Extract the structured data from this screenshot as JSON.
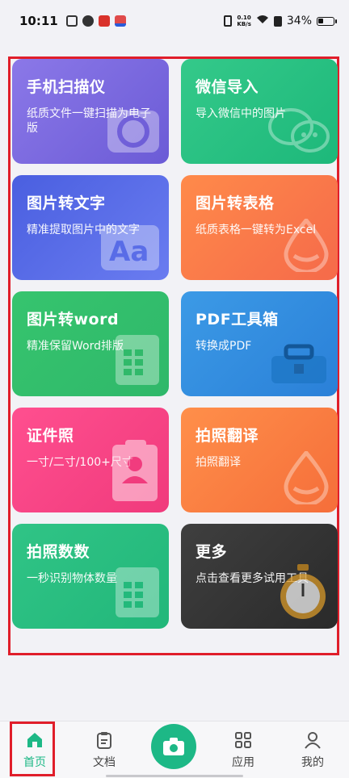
{
  "status_bar": {
    "time": "10:11",
    "netspeed_value": "0.10",
    "netspeed_unit": "KB/s",
    "battery": "34%"
  },
  "tools": [
    {
      "title": "手机扫描仪",
      "subtitle": "纸质文件一键扫描为电子版",
      "color": "#7a6ae0",
      "icon": "camera-lens-icon"
    },
    {
      "title": "微信导入",
      "subtitle": "导入微信中的图片",
      "color": "#25c182",
      "icon": "wechat-icon"
    },
    {
      "title": "图片转文字",
      "subtitle": "精准提取图片中的文字",
      "color": "#5a6ee8",
      "icon": "text-aa-icon"
    },
    {
      "title": "图片转表格",
      "subtitle": "纸质表格一键转为Excel",
      "color": "#f97a45",
      "icon": "drop-icon"
    },
    {
      "title": "图片转word",
      "subtitle": "精准保留Word排版",
      "color": "#33be6c",
      "icon": "document-table-icon"
    },
    {
      "title": "PDF工具箱",
      "subtitle": "转换成PDF",
      "color": "#338dde",
      "icon": "toolbox-icon"
    },
    {
      "title": "证件照",
      "subtitle": "一寸/二寸/100+尺寸",
      "color": "#f74585",
      "icon": "id-photo-icon"
    },
    {
      "title": "拍照翻译",
      "subtitle": "拍照翻译",
      "color": "#f98044",
      "icon": "drop-icon"
    },
    {
      "title": "拍照数数",
      "subtitle": "一秒识别物体数量",
      "color": "#29bd80",
      "icon": "document-table-icon"
    },
    {
      "title": "更多",
      "subtitle": "点击查看更多试用工具",
      "color": "#333333",
      "icon": "stopwatch-icon"
    }
  ],
  "nav": {
    "home": "首页",
    "docs": "文档",
    "apps": "应用",
    "mine": "我的"
  }
}
